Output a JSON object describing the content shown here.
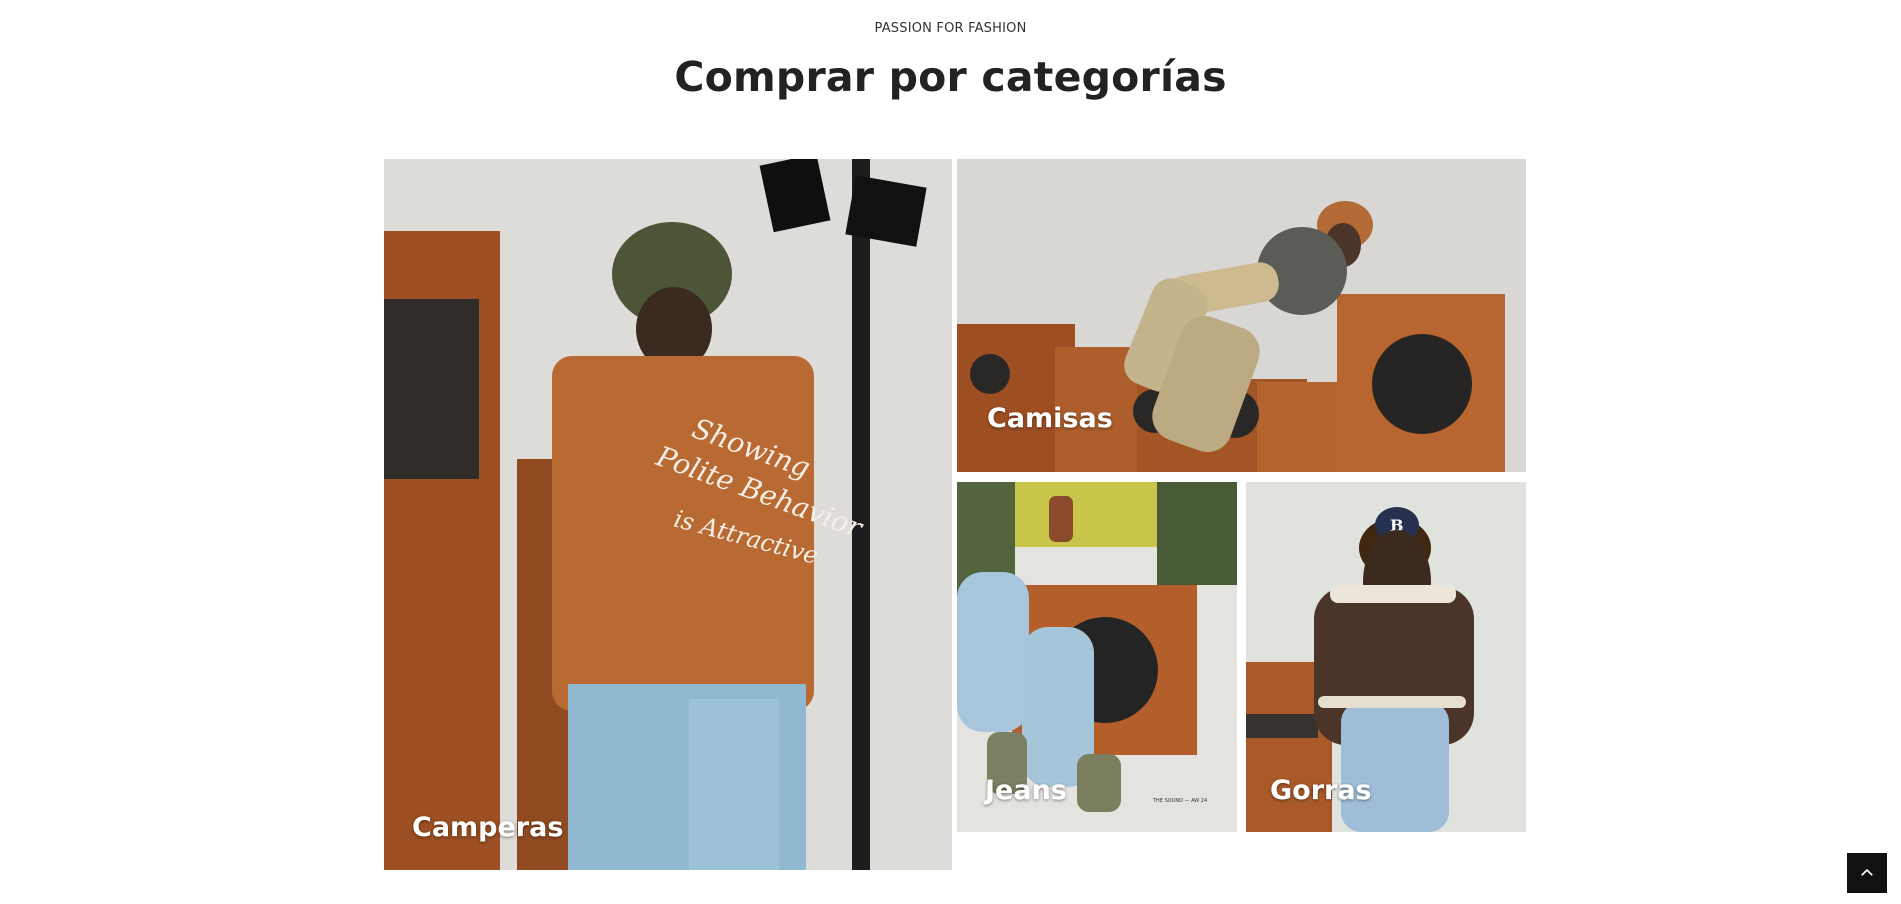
{
  "section": {
    "eyebrow": "PASSION FOR FASHION",
    "title": "Comprar por categorías"
  },
  "categories": [
    {
      "label": "Camperas"
    },
    {
      "label": "Camisas"
    },
    {
      "label": "Jeans"
    },
    {
      "label": "Gorras"
    }
  ],
  "back_to_top": {
    "icon": "chevron-up-icon"
  },
  "colors": {
    "title": "#222222",
    "eyebrow": "#333333",
    "back_to_top_bg": "#111111"
  }
}
